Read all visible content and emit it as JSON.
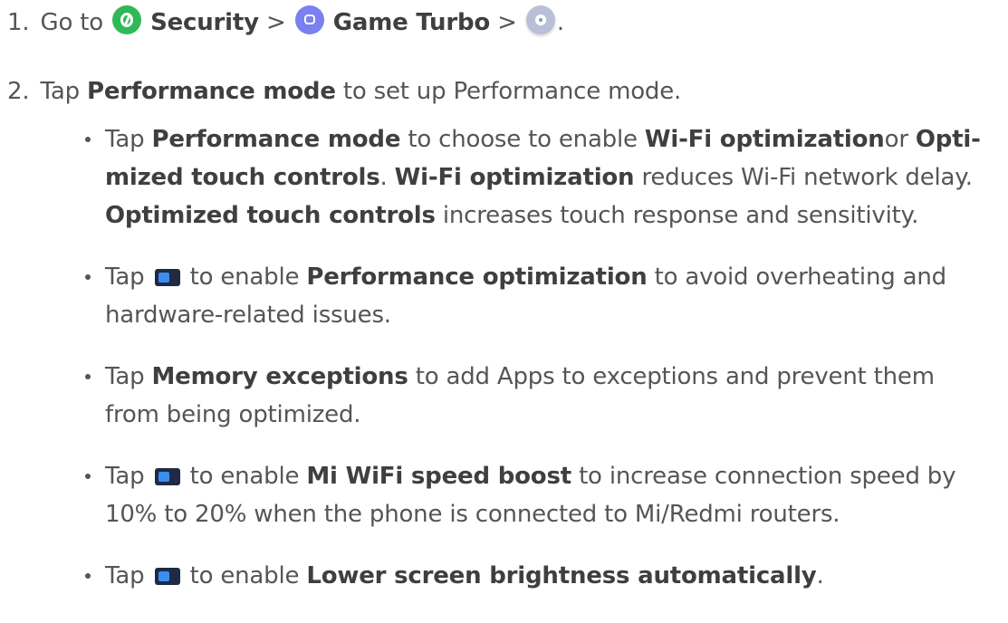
{
  "step1": {
    "number": "1.",
    "go_to": "Go to",
    "security": "Security",
    "sep1": ">",
    "game_turbo": "Game Turbo",
    "sep2": ">",
    "end": ".",
    "icons": [
      "security-app-icon",
      "game-turbo-app-icon",
      "settings-gear-icon"
    ]
  },
  "step2": {
    "number": "2.",
    "tap": "Tap",
    "performance_mode": "Performance mode",
    "rest": "to set up Performance mode."
  },
  "bullets": {
    "b1": {
      "line1_tap": "Tap",
      "line1_bold1": "Performance mode",
      "line1_mid": "to choose to enable",
      "line1_bold2": "Wi-Fi optimization",
      "line1_or": "or",
      "line1_bold3": "Opti-",
      "line2_bold1": "mized touch controls",
      "line2_dot": ".",
      "line2_bold2": "Wi-Fi optimization",
      "line2_rest": "reduces Wi-Fi network delay.",
      "line3_bold": "Optimized touch controls",
      "line3_rest": "increases touch response and sensitivity."
    },
    "b2": {
      "tap": "Tap",
      "to_enable": "to enable",
      "bold": "Performance optimization",
      "line1_rest": "to avoid overheating and",
      "line2": "hardware-related issues."
    },
    "b3": {
      "tap": "Tap",
      "bold": "Memory exceptions",
      "line1_rest": "to add Apps to exceptions and prevent them",
      "line2": "from being optimized."
    },
    "b4": {
      "tap": "Tap",
      "to_enable": "to enable",
      "bold": "Mi WiFi speed boost",
      "line1_rest": "to increase connection speed by",
      "line2": "10% to 20% when the phone is connected to Mi/Redmi routers."
    },
    "b5": {
      "tap": "Tap",
      "to_enable": "to enable",
      "bold": "Lower screen brightness automatically",
      "end": "."
    }
  },
  "colors": {
    "text": "#555555",
    "bold_text": "#3f3f3f",
    "security_icon": "#2fb855",
    "game_turbo_icon": "#7a80f0",
    "settings_icon": "#b9bfd6",
    "toggle_icon": "#1f2a44"
  }
}
